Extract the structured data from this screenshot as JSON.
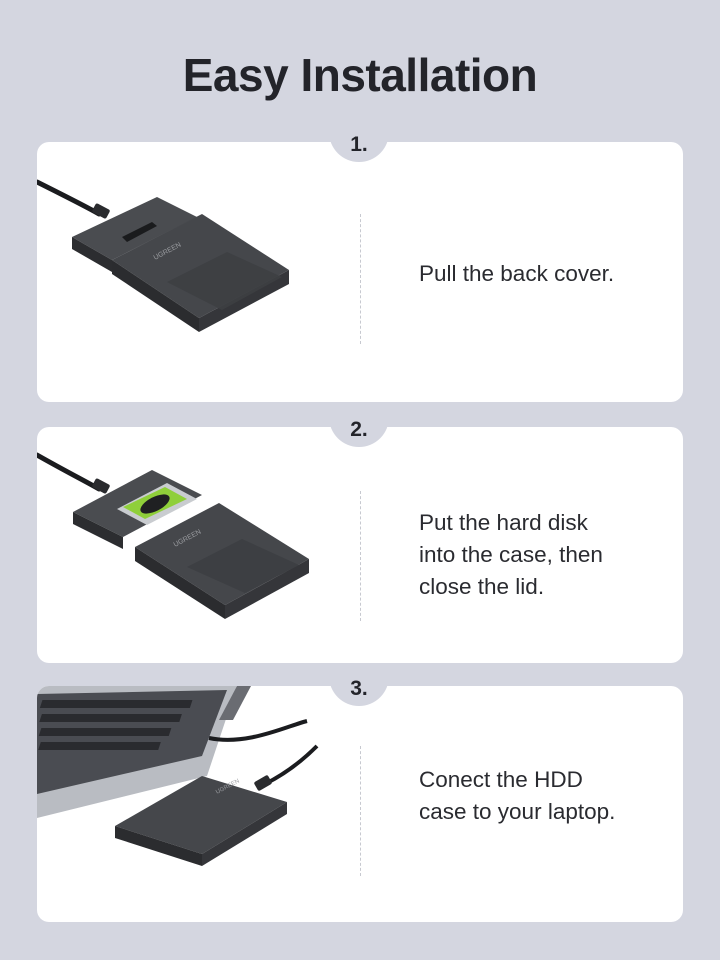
{
  "header": {
    "title": "Easy Installation"
  },
  "steps": [
    {
      "number": "1.",
      "lines": [
        "Pull the back cover."
      ]
    },
    {
      "number": "2.",
      "lines": [
        "Put the hard disk",
        "into the case, then",
        "close the lid."
      ]
    },
    {
      "number": "3.",
      "lines": [
        "Conect the HDD",
        "case to your laptop."
      ]
    }
  ],
  "brand": {
    "logo_text": "UGREEN"
  },
  "colors": {
    "background": "#d4d6e0",
    "card": "#ffffff",
    "text": "#23242a",
    "enclosure": "#3a3c40"
  }
}
